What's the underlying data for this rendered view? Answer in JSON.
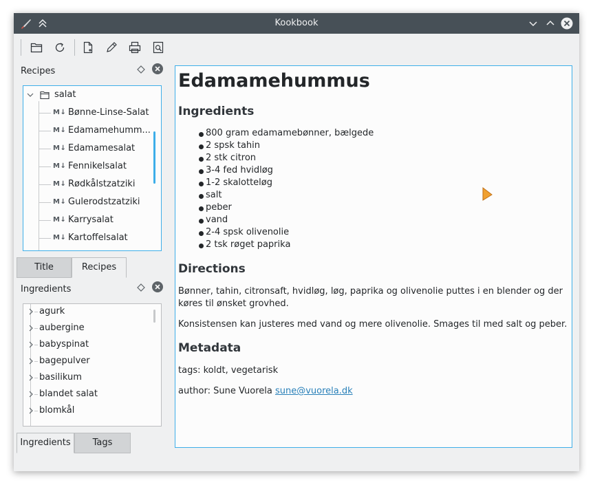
{
  "window": {
    "title": "Kookbook"
  },
  "recipes_dock": {
    "title": "Recipes",
    "folder": "salat",
    "items": [
      "Bønne-Linse-Salat",
      "Edamamehumm...",
      "Edamamesalat",
      "Fennikelsalat",
      "Rødkålstzatziki",
      "Gulerodstzatziki",
      "Karrysalat",
      "Kartoffelsalat"
    ],
    "md_badge": "M↓",
    "tabs": [
      "Title",
      "Recipes"
    ]
  },
  "ingredients_dock": {
    "title": "Ingredients",
    "items": [
      "agurk",
      "aubergine",
      "babyspinat",
      "bagepulver",
      "basilikum",
      "blandet salat",
      "blomkål"
    ],
    "tabs": [
      "Ingredients",
      "Tags"
    ]
  },
  "recipe": {
    "title": "Edamamehummus",
    "ingredients_heading": "Ingredients",
    "ingredients": [
      "800 gram edamamebønner, bælgede",
      "2 spsk tahin",
      "2 stk citron",
      "3-4 fed hvidløg",
      "1-2 skalotteløg",
      "salt",
      "peber",
      "vand",
      "2-4 spsk olivenolie",
      "2 tsk røget paprika"
    ],
    "directions_heading": "Directions",
    "directions": [
      "Bønner, tahin, citronsaft, hvidløg, løg, paprika og olivenolie puttes i en blender og der køres til ønsket grovhed.",
      "Konsistensen kan justeres med vand og mere olivenolie. Smages til med salt og peber."
    ],
    "metadata_heading": "Metadata",
    "tags_line": "tags: koldt, vegetarisk",
    "author_prefix": "author: Sune Vuorela",
    "author_email": "sune@vuorela.dk"
  },
  "icons": {
    "app": "knife-icon",
    "keep_above": "keep-above-icon",
    "minimize": "chevron-down-icon",
    "maximize": "chevron-up-icon",
    "close": "close-icon",
    "open": "folder-open-icon",
    "reload": "reload-icon",
    "new": "new-document-icon",
    "edit": "edit-pencil-icon",
    "print": "print-icon",
    "preview": "print-preview-icon"
  },
  "colors": {
    "titlebar": "#475057",
    "accent": "#3daee9",
    "link": "#2980b9",
    "cursor": "#f0a030"
  }
}
